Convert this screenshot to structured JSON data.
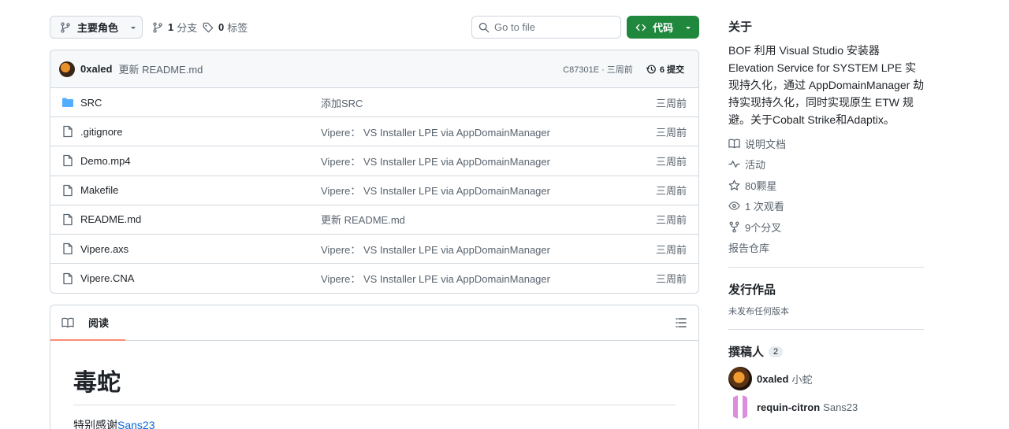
{
  "toolbar": {
    "branch_label": "主要角色",
    "branches_count": "1",
    "branches_label": "分支",
    "tags_count": "0",
    "tags_label": "标签",
    "goto_placeholder": "Go to file",
    "code_label": "代码"
  },
  "commit": {
    "author": "0xaled",
    "message": "更新 README.md",
    "hash_time": "C87301E · 三周前",
    "commits_label": "6 提交"
  },
  "files": [
    {
      "type": "folder",
      "name": "SRC",
      "message": "添加SRC",
      "date": "三周前"
    },
    {
      "type": "file",
      "name": ".gitignore",
      "message": "Vipere： VS Installer LPE via AppDomainManager",
      "date": "三周前"
    },
    {
      "type": "file",
      "name": "Demo.mp4",
      "message": "Vipere： VS Installer LPE via AppDomainManager",
      "date": "三周前"
    },
    {
      "type": "file",
      "name": "Makefile",
      "message": "Vipere： VS Installer LPE via AppDomainManager",
      "date": "三周前"
    },
    {
      "type": "file",
      "name": "README.md",
      "message": "更新 README.md",
      "date": "三周前"
    },
    {
      "type": "file",
      "name": "Vipere.axs",
      "message": "Vipere： VS Installer LPE via AppDomainManager",
      "date": "三周前"
    },
    {
      "type": "file",
      "name": "Vipere.CNA",
      "message": "Vipere： VS Installer LPE via AppDomainManager",
      "date": "三周前"
    }
  ],
  "readme": {
    "tab_label": "阅读",
    "title": "毒蛇",
    "thanks_prefix": "特别感谢",
    "thanks_link": "Sans23"
  },
  "sidebar": {
    "about_title": "关于",
    "description": "BOF 利用 Visual Studio 安装器 Elevation Service for SYSTEM LPE 实现持久化，通过 AppDomainManager 劫持实现持久化，同时实现原生 ETW 规避。关于Cobalt Strike和Adaptix。",
    "links": {
      "readme": "说明文档",
      "activity": "活动",
      "stars": "80颗星",
      "watching": "1 次观看",
      "forks": "9个分叉",
      "report": "报告仓库"
    },
    "releases_title": "发行作品",
    "no_releases": "未发布任何版本",
    "contributors_title": "撰稿人",
    "contributors_count": "2",
    "contributors": [
      {
        "login": "0xaled",
        "name": "小蛇"
      },
      {
        "login": "requin-citron",
        "name": "Sans23"
      }
    ]
  },
  "colors": {
    "accent_green": "#1f883d",
    "folder_blue": "#54aeff",
    "link_blue": "#0969da",
    "tab_underline": "#fd8c73"
  }
}
